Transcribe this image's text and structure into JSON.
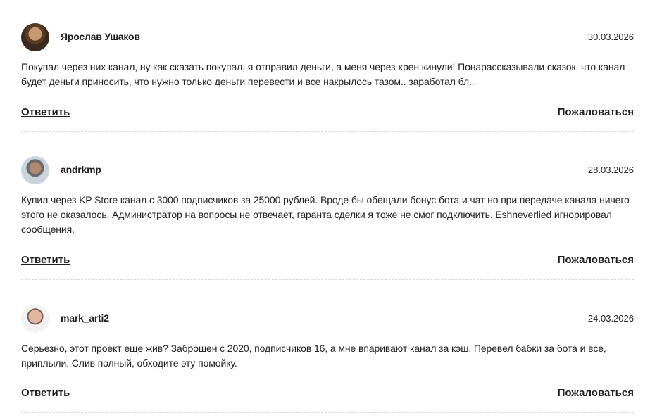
{
  "comments": [
    {
      "author": "Ярослав Ушаков",
      "date": "30.03.2026",
      "text": "Покупал через них канал, ну как сказать покупал, я отправил деньги, а меня через хрен кинули! Понарассказывали сказок, что канал будет деньги приносить, что нужно только деньги перевести и все накрылось тазом.. заработал бл..",
      "reply_label": "Ответить",
      "report_label": "Пожаловаться"
    },
    {
      "author": "andrkmp",
      "date": "28.03.2026",
      "text": "Купил через KP Store канал с 3000 подписчиков за 25000 рублей. Вроде бы обещали бонус бота и чат но при передаче канала ничего этого не оказалось. Администратор на вопросы не отвечает, гаранта сделки я тоже не смог подключить. Eshneverlied игнорировал сообщения.",
      "reply_label": "Ответить",
      "report_label": "Пожаловаться"
    },
    {
      "author": "mark_arti2",
      "date": "24.03.2026",
      "text": "Серьезно, этот проект еще жив? Заброшен с 2020, подписчиков 16, а мне впаривают канал за кэш. Перевел бабки за бота и все, приплыли. Слив полный, обходите эту помойку.",
      "reply_label": "Ответить",
      "report_label": "Пожаловаться"
    }
  ]
}
